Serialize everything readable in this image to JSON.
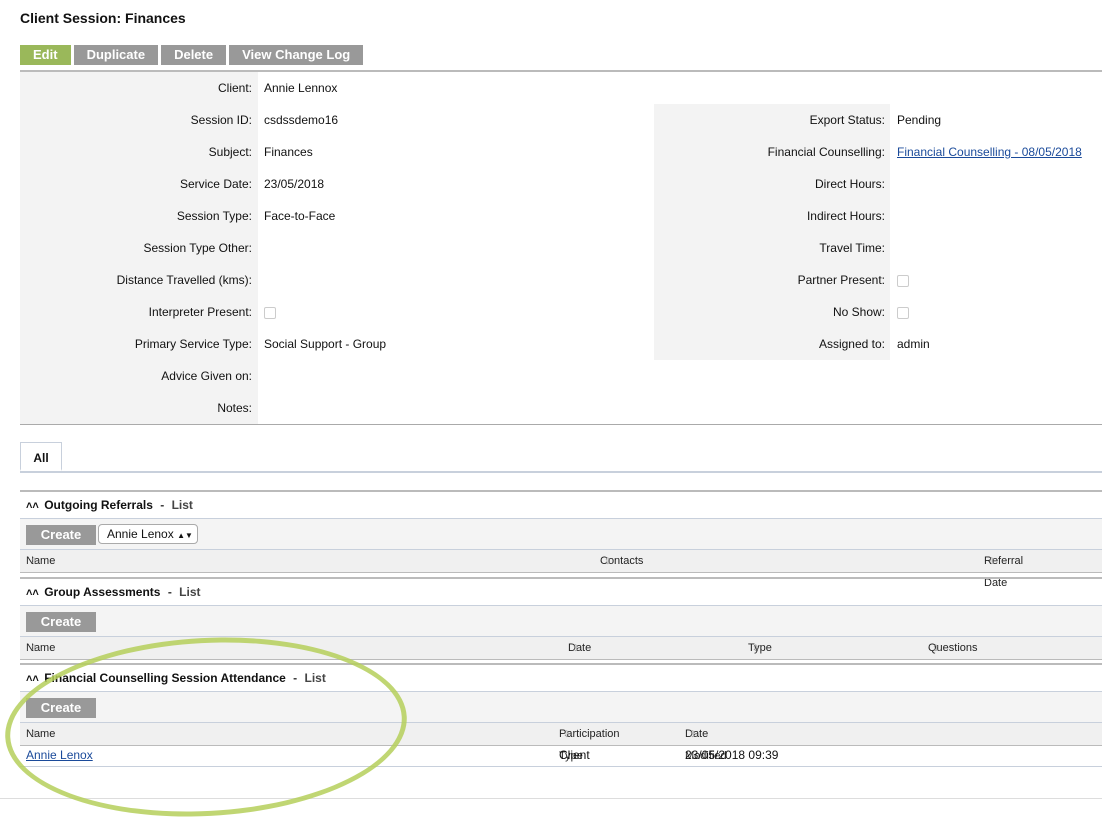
{
  "page": {
    "title": "Client Session: Finances"
  },
  "toolbar": {
    "edit": "Edit",
    "duplicate": "Duplicate",
    "delete": "Delete",
    "changelog": "View Change Log"
  },
  "details": {
    "left": [
      {
        "label": "Client:",
        "value": "Annie Lennox"
      },
      {
        "label": "Session ID:",
        "value": "csdssdemo16"
      },
      {
        "label": "Subject:",
        "value": "Finances"
      },
      {
        "label": "Service Date:",
        "value": "23/05/2018"
      },
      {
        "label": "Session Type:",
        "value": "Face-to-Face"
      },
      {
        "label": "Session Type Other:",
        "value": ""
      },
      {
        "label": "Distance Travelled (kms):",
        "value": ""
      },
      {
        "label": "Interpreter Present:",
        "value": ""
      },
      {
        "label": "Primary Service Type:",
        "value": "Social Support - Group"
      },
      {
        "label": "Advice Given on:",
        "value": ""
      },
      {
        "label": "Notes:",
        "value": ""
      }
    ],
    "right": [
      {
        "label": "Export Status:",
        "value": "Pending"
      },
      {
        "label": "Financial Counselling:",
        "value": "Financial Counselling - 08/05/2018"
      },
      {
        "label": "Direct Hours:",
        "value": ""
      },
      {
        "label": "Indirect Hours:",
        "value": ""
      },
      {
        "label": "Travel Time:",
        "value": ""
      },
      {
        "label": "Partner Present:",
        "value": ""
      },
      {
        "label": "No Show:",
        "value": ""
      },
      {
        "label": "Assigned to:",
        "value": "admin"
      }
    ]
  },
  "tabs": {
    "all": "All"
  },
  "sections": {
    "referrals": {
      "title": "Outgoing Referrals",
      "sep": "-",
      "list": "List",
      "create": "Create",
      "select_value": "Annie Lenox",
      "columns": {
        "name": "Name",
        "contacts": "Contacts",
        "referral_date": "Referral Date"
      }
    },
    "assessments": {
      "title": "Group Assessments",
      "sep": "-",
      "list": "List",
      "create": "Create",
      "columns": {
        "name": "Name",
        "date": "Date",
        "type": "Type",
        "questions": "Questions"
      }
    },
    "attendance": {
      "title": "Financial Counselling Session Attendance",
      "sep": "-",
      "list": "List",
      "create": "Create",
      "columns": {
        "name": "Name",
        "participation": "Participation Type",
        "modified": "Date Modified"
      },
      "rows": [
        {
          "name": "Annie Lenox",
          "participation": "Client",
          "modified": "23/05/2018 09:39"
        }
      ]
    }
  },
  "colors": {
    "edit_green": "#9ab85a",
    "button_gray": "#999999",
    "link": "#1a4a9a",
    "highlight": "#b5cf5a"
  }
}
